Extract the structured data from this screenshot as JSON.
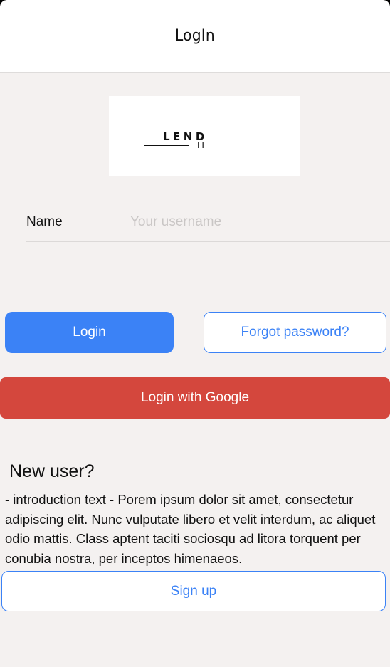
{
  "header": {
    "title": "LogIn"
  },
  "logo": {
    "word": "LEND",
    "sub": "IT"
  },
  "form": {
    "name_label": "Name",
    "name_placeholder": "Your username",
    "name_value": ""
  },
  "buttons": {
    "login": "Login",
    "forgot": "Forgot password?",
    "google": "Login with Google",
    "signup": "Sign up"
  },
  "new_user": {
    "title": "New user?",
    "intro": "- introduction text - Porem ipsum dolor sit amet, consectetur adipiscing elit. Nunc vulputate libero et velit interdum, ac aliquet odio mattis. Class aptent taciti sociosqu ad litora torquent per conubia nostra, per inceptos himenaeos."
  },
  "colors": {
    "primary": "#3b82f6",
    "google": "#d4473d",
    "background": "#f4f1f0"
  }
}
